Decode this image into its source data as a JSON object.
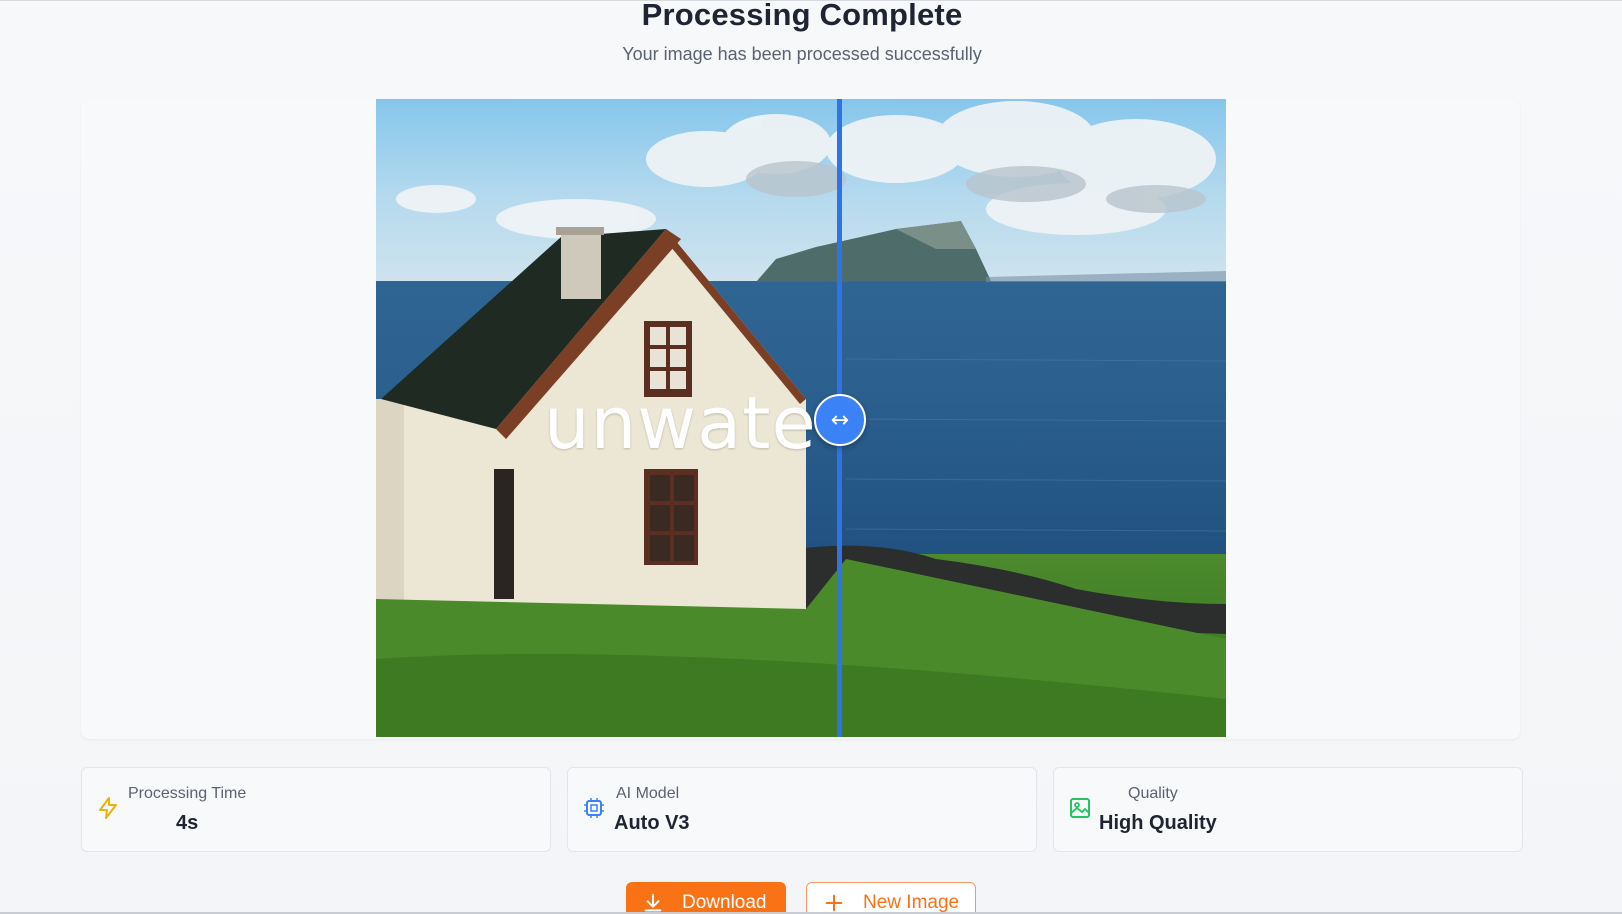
{
  "header": {
    "title": "Processing Complete",
    "subtitle": "Your image has been processed successfully"
  },
  "comparison": {
    "watermark_text": "unwate",
    "divider_position": 0.544,
    "handle_icon": "horizontal-arrows-icon",
    "handle_glyph": "↔"
  },
  "stats": [
    {
      "label": "Processing Time",
      "value": "4s",
      "icon": "lightning-icon",
      "color": "#eab308"
    },
    {
      "label": "AI Model",
      "value": "Auto V3",
      "icon": "chip-icon",
      "color": "#3b82f6"
    },
    {
      "label": "Quality",
      "value": "High Quality",
      "icon": "image-icon",
      "color": "#22c55e"
    }
  ],
  "actions": {
    "download_label": "Download",
    "new_image_label": "New Image"
  },
  "colors": {
    "accent": "#f97316",
    "handle": "#3b82f6"
  }
}
